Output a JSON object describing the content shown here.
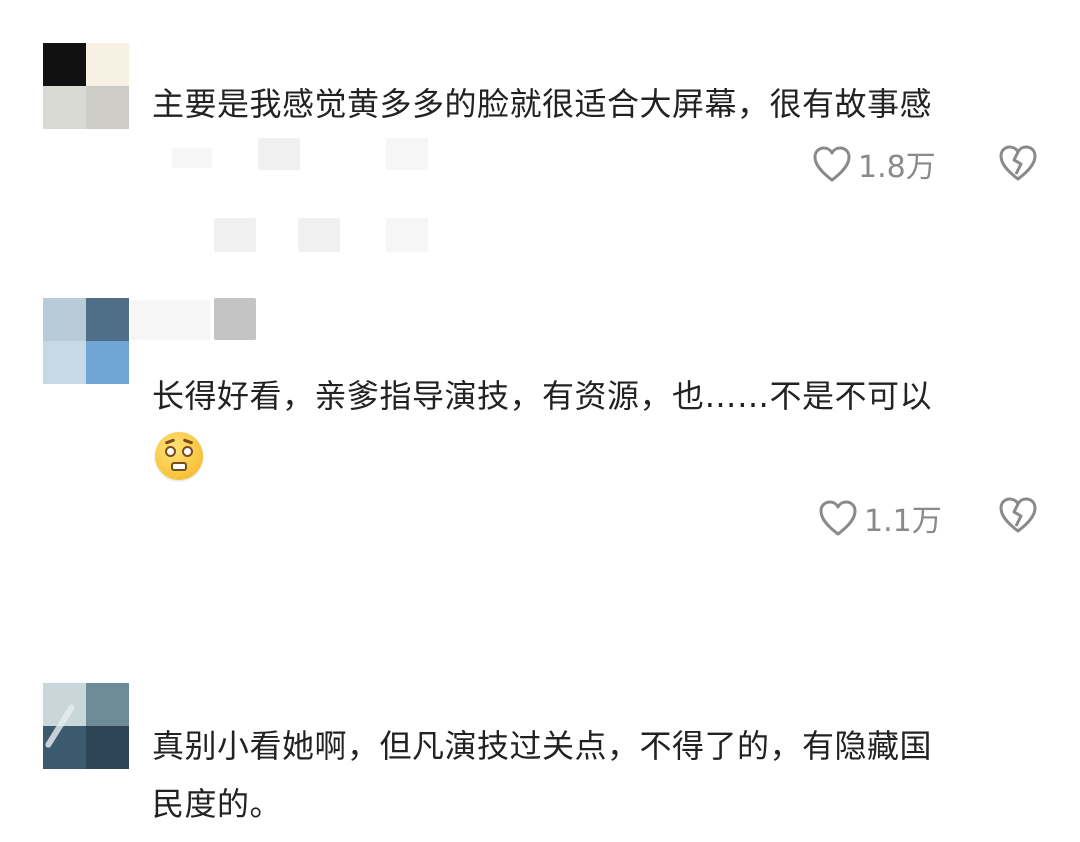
{
  "comments": [
    {
      "text": "主要是我感觉黄多多的脸就很适合大屏幕，很有故事感",
      "likes": "1.8万"
    },
    {
      "text": "长得好看，亲爹指导演技，有资源，也……不是不可以",
      "emoji": "pleading-face-emoji",
      "likes": "1.1万"
    },
    {
      "text_line1": "真别小看她啊，但凡演技过关点，不得了的，有隐藏国",
      "text_line2": "民度的。"
    }
  ],
  "icons": {
    "like": "heart-outline-icon",
    "dislike": "broken-heart-icon"
  },
  "colors": {
    "text": "#222222",
    "meta": "#8a8a8a"
  }
}
